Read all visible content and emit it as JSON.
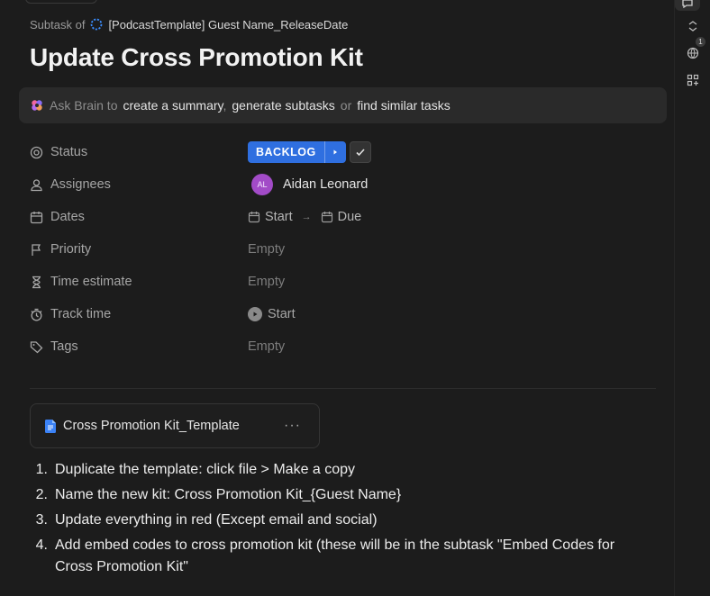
{
  "breadcrumb": {
    "prefix": "Subtask of",
    "parent_task": "[PodcastTemplate] Guest Name_ReleaseDate"
  },
  "task": {
    "title": "Update Cross Promotion Kit"
  },
  "brain": {
    "prompt": "Ask Brain to",
    "action_1": "create a summary",
    "separator": ",",
    "action_2": "generate subtasks",
    "or_text": "or",
    "action_3": "find similar tasks"
  },
  "fields": {
    "status": {
      "label": "Status",
      "value": "BACKLOG",
      "color": "#2f6fe0"
    },
    "assignees": {
      "label": "Assignees",
      "initials": "AL",
      "name": "Aidan Leonard",
      "avatar_color": "#a24bc7"
    },
    "dates": {
      "label": "Dates",
      "start": "Start",
      "due": "Due"
    },
    "priority": {
      "label": "Priority",
      "value": "Empty"
    },
    "time_estimate": {
      "label": "Time estimate",
      "value": "Empty"
    },
    "track_time": {
      "label": "Track time",
      "value": "Start"
    },
    "tags": {
      "label": "Tags",
      "value": "Empty"
    }
  },
  "attachment": {
    "name": "Cross Promotion Kit_Template",
    "more": "···"
  },
  "steps": [
    {
      "num": "1.",
      "text": "Duplicate the template: click file > Make a copy"
    },
    {
      "num": "2.",
      "text": "Name the new kit: Cross Promotion Kit_{Guest Name}"
    },
    {
      "num": "3.",
      "text": "Update everything in red (Except email and social)"
    },
    {
      "num": "4.",
      "text": "Add embed codes to cross promotion kit (these will be in the subtask \"Embed Codes for Cross Promotion Kit\""
    }
  ],
  "rail": {
    "activity_badge": "1"
  }
}
